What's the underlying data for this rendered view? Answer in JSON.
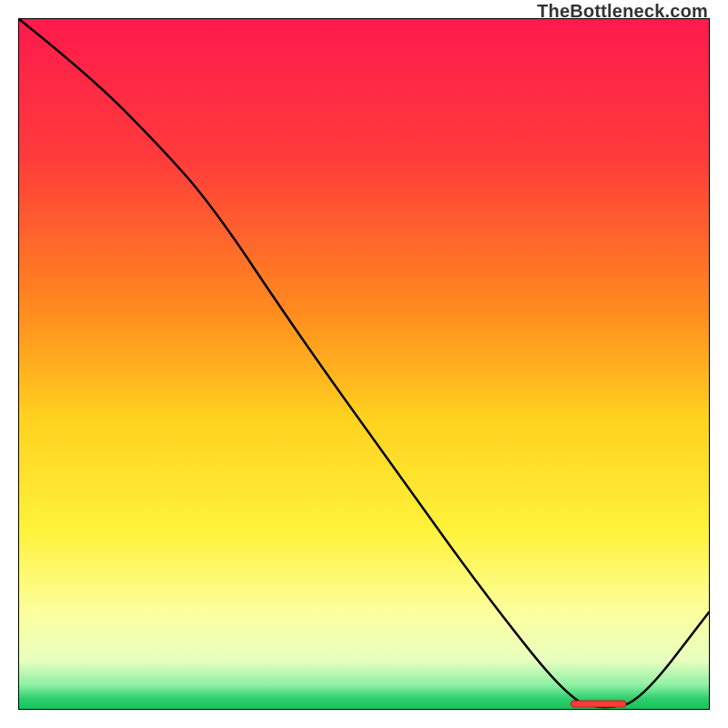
{
  "watermark": "TheBottleneck.com",
  "chart_data": {
    "type": "line",
    "title": "",
    "xlabel": "",
    "ylabel": "",
    "xlim": [
      0,
      100
    ],
    "ylim": [
      0,
      100
    ],
    "series": [
      {
        "name": "curve",
        "x": [
          0,
          10,
          20,
          28,
          40,
          55,
          68,
          80,
          85,
          90,
          100
        ],
        "y": [
          100,
          92,
          82,
          73,
          55,
          34,
          16,
          1,
          0,
          1,
          14
        ]
      }
    ],
    "marker": {
      "x_start": 80,
      "x_end": 88,
      "y": 0
    },
    "gradient_stops": [
      {
        "offset": 0.0,
        "color": "#ff1a4d"
      },
      {
        "offset": 0.2,
        "color": "#ff3b3b"
      },
      {
        "offset": 0.42,
        "color": "#ff8a1f"
      },
      {
        "offset": 0.58,
        "color": "#ffd21f"
      },
      {
        "offset": 0.74,
        "color": "#fff23a"
      },
      {
        "offset": 0.86,
        "color": "#fcff9e"
      },
      {
        "offset": 0.93,
        "color": "#e8ffc0"
      },
      {
        "offset": 0.965,
        "color": "#8ff0a4"
      },
      {
        "offset": 0.985,
        "color": "#2ecf6e"
      },
      {
        "offset": 1.0,
        "color": "#14c45a"
      }
    ]
  }
}
